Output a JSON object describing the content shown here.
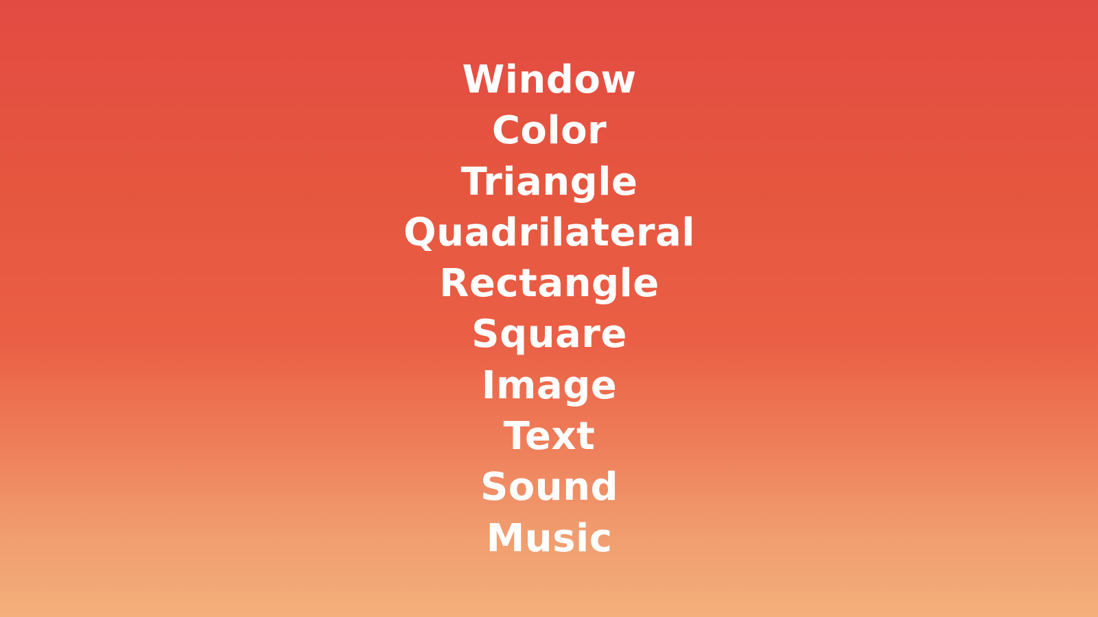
{
  "background": {
    "gradient_top": "#e24b42",
    "gradient_bottom": "#f4b07b",
    "text_color": "#ffffff"
  },
  "words": [
    "Window",
    "Color",
    "Triangle",
    "Quadrilateral",
    "Rectangle",
    "Square",
    "Image",
    "Text",
    "Sound",
    "Music"
  ]
}
